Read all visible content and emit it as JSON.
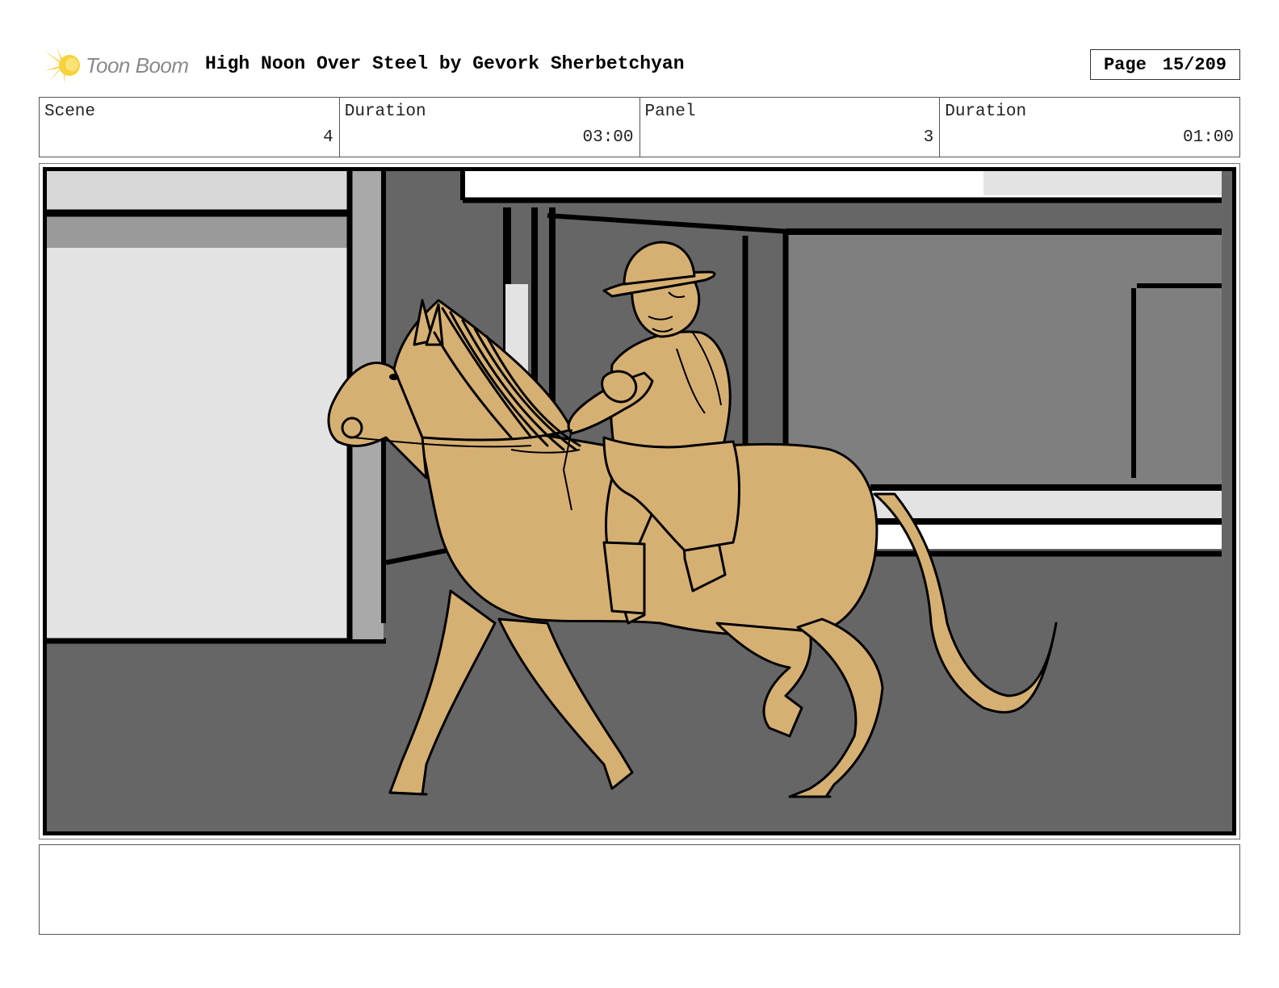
{
  "header": {
    "logo_text": "Toon Boom",
    "logo_icon": "toon-boom-burst-icon",
    "title": "High Noon Over Steel by Gevork Sherbetchyan",
    "page_label": "Page",
    "page_number": "15/209"
  },
  "info": {
    "scene_label": "Scene",
    "scene_value": "4",
    "scene_duration_label": "Duration",
    "scene_duration_value": "03:00",
    "panel_label": "Panel",
    "panel_value": "3",
    "panel_duration_label": "Duration",
    "panel_duration_value": "01:00"
  },
  "panel_image": {
    "description_icon": "storyboard-sketch-rider-on-horse",
    "colors": {
      "ground": "#666666",
      "wall_light": "#e3e3e3",
      "wall_mid": "#7f7f7f",
      "pillar": "#a9a9a9",
      "horse": "#d6b073",
      "ink": "#000000"
    }
  },
  "notes": {
    "text": ""
  }
}
